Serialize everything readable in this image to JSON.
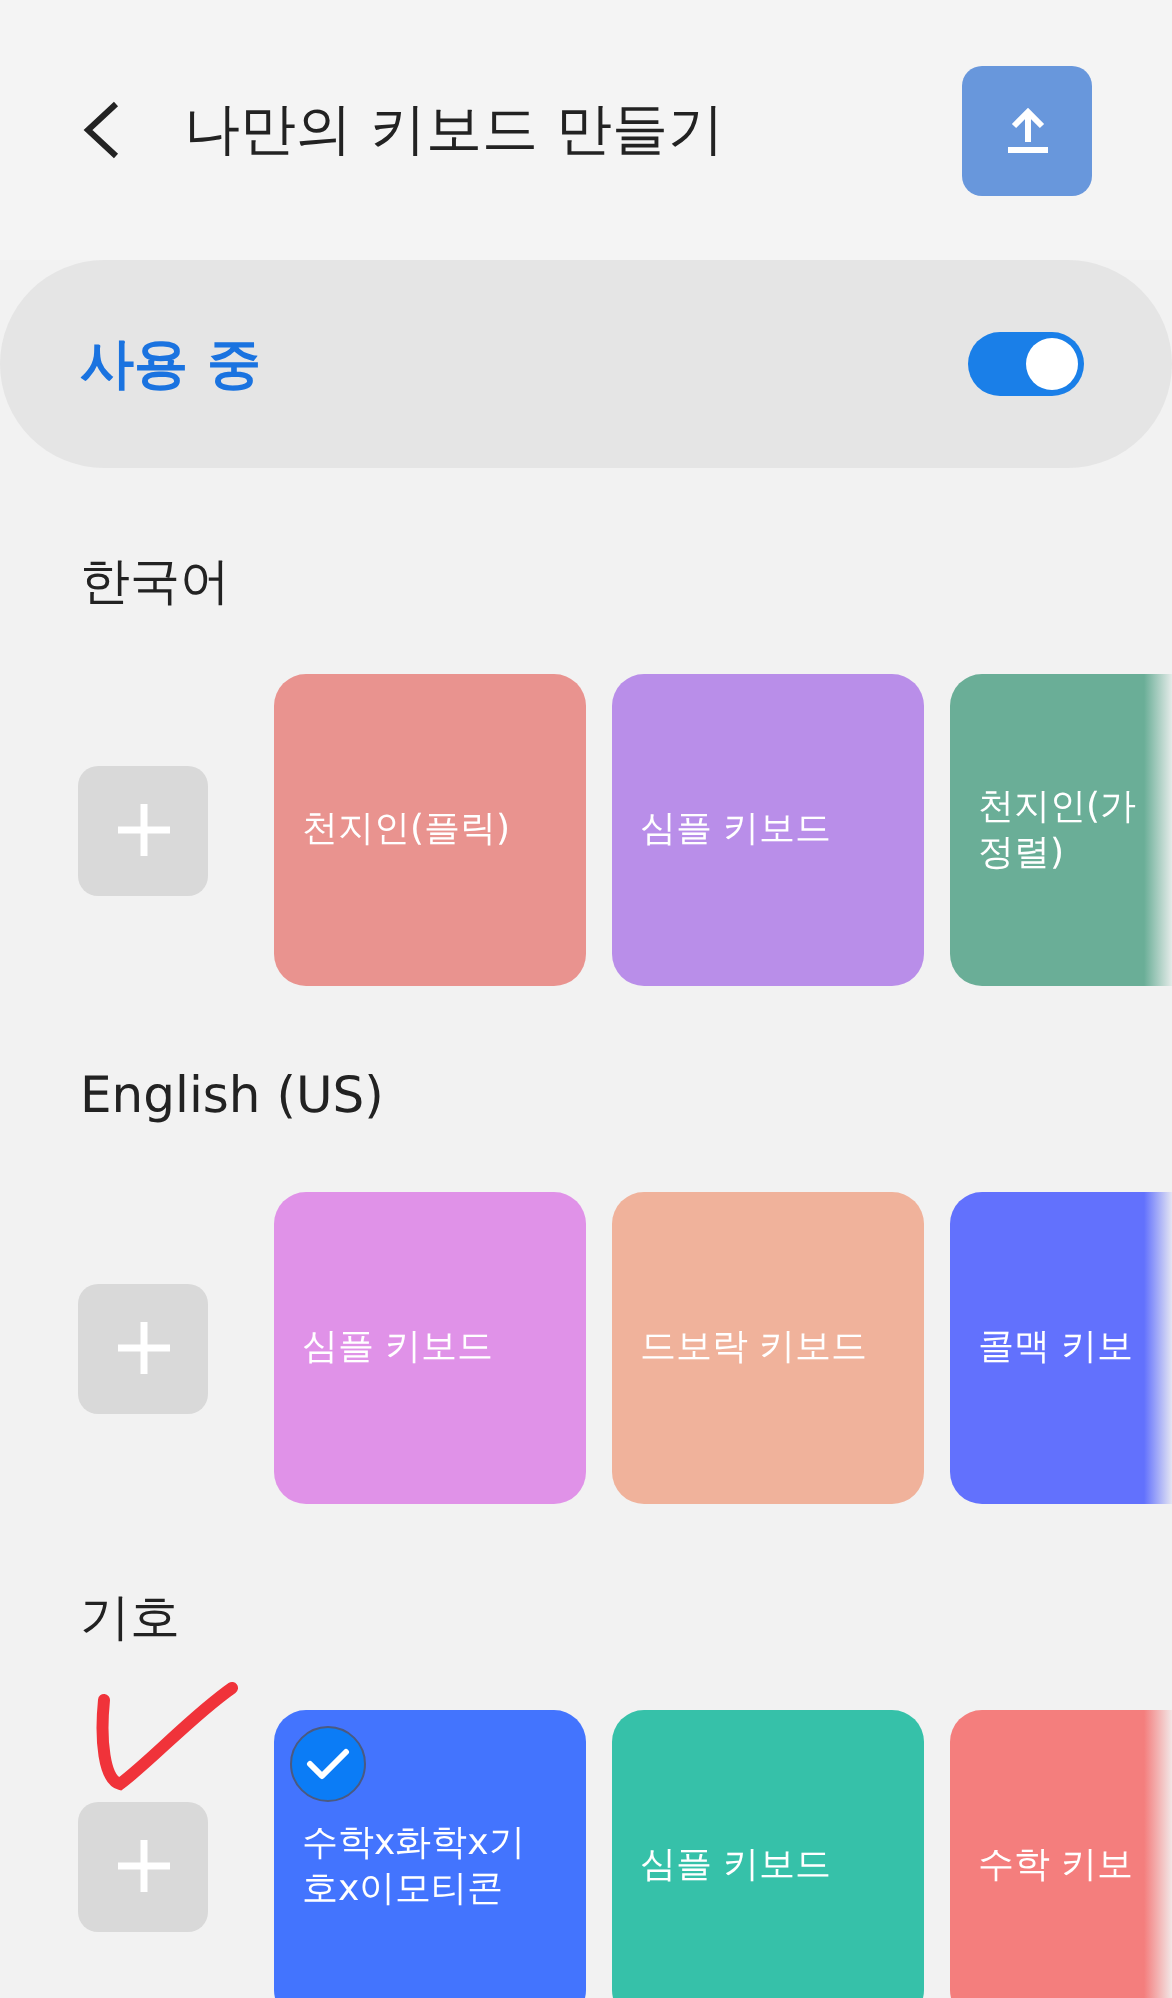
{
  "header": {
    "title": "나만의 키보드 만들기"
  },
  "usage": {
    "label": "사용 중",
    "on": true
  },
  "sections": [
    {
      "title": "한국어",
      "cards": [
        {
          "label": "천지인(플릭)",
          "color": "#e9938f",
          "selected": false
        },
        {
          "label": "심플 키보드",
          "color": "#b98ee9",
          "selected": false
        },
        {
          "label": "천지인(가\n정렬)",
          "color": "#6aae97",
          "selected": false
        }
      ]
    },
    {
      "title": "English (US)",
      "cards": [
        {
          "label": "심플 키보드",
          "color": "#e092e8",
          "selected": false
        },
        {
          "label": "드보락 키보드",
          "color": "#f0b29b",
          "selected": false
        },
        {
          "label": "콜맥 키보",
          "color": "#6271fd",
          "selected": false
        }
      ]
    },
    {
      "title": "기호",
      "cards": [
        {
          "label": "수학x화학x기\n호x이모티콘",
          "color": "#4374fe",
          "selected": true
        },
        {
          "label": "심플 키보드",
          "color": "#36c1a9",
          "selected": false
        },
        {
          "label": "수학 키보",
          "color": "#f47e7d",
          "selected": false
        }
      ]
    }
  ],
  "annotation": {
    "kind": "checkmark"
  }
}
